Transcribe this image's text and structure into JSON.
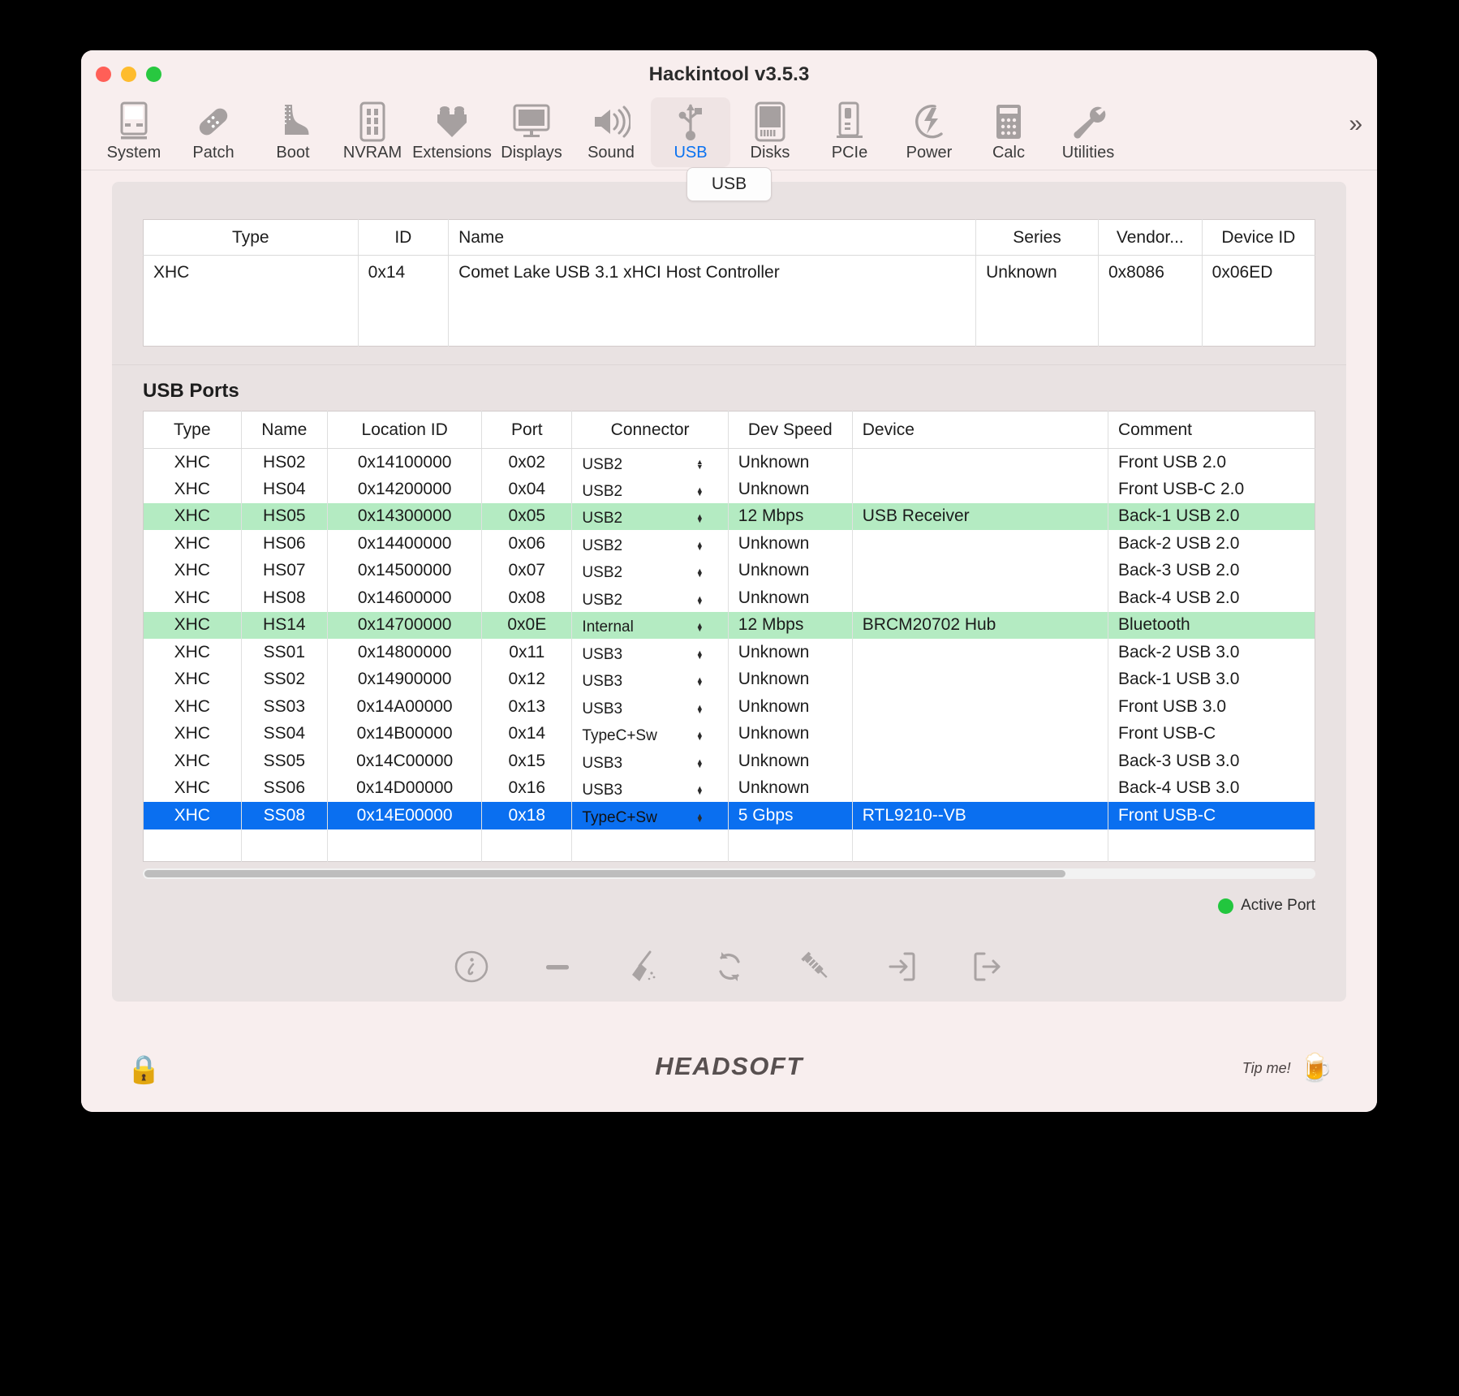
{
  "window": {
    "title": "Hackintool v3.5.3"
  },
  "toolbar": {
    "items": [
      {
        "label": "System",
        "icon": "computer-icon"
      },
      {
        "label": "Patch",
        "icon": "bandage-icon"
      },
      {
        "label": "Boot",
        "icon": "boot-icon"
      },
      {
        "label": "NVRAM",
        "icon": "memory-icon"
      },
      {
        "label": "Extensions",
        "icon": "lego-brick-icon"
      },
      {
        "label": "Displays",
        "icon": "monitor-icon"
      },
      {
        "label": "Sound",
        "icon": "speaker-icon"
      },
      {
        "label": "USB",
        "icon": "usb-icon",
        "active": true
      },
      {
        "label": "Disks",
        "icon": "disk-icon"
      },
      {
        "label": "PCIe",
        "icon": "pcie-card-icon"
      },
      {
        "label": "Power",
        "icon": "bolt-icon"
      },
      {
        "label": "Calc",
        "icon": "calculator-icon"
      },
      {
        "label": "Utilities",
        "icon": "wrench-icon"
      }
    ],
    "overflow": "»"
  },
  "tab": {
    "label": "USB"
  },
  "controller_table": {
    "columns": [
      "Type",
      "ID",
      "Name",
      "Series",
      "Vendor...",
      "Device ID"
    ],
    "rows": [
      {
        "type": "XHC",
        "id": "0x14",
        "name": "Comet Lake USB 3.1 xHCI Host Controller",
        "series": "Unknown",
        "vendor": "0x8086",
        "device_id": "0x06ED"
      }
    ]
  },
  "ports_section": {
    "title": "USB Ports",
    "columns": [
      "Type",
      "Name",
      "Location ID",
      "Port",
      "Connector",
      "Dev Speed",
      "Device",
      "Comment"
    ],
    "rows": [
      {
        "type": "XHC",
        "name": "HS02",
        "location_id": "0x14100000",
        "port": "0x02",
        "connector": "USB2",
        "dev_speed": "Unknown",
        "device": "",
        "comment": "Front USB 2.0",
        "state": "normal"
      },
      {
        "type": "XHC",
        "name": "HS04",
        "location_id": "0x14200000",
        "port": "0x04",
        "connector": "USB2",
        "dev_speed": "Unknown",
        "device": "",
        "comment": "Front USB-C 2.0",
        "state": "normal"
      },
      {
        "type": "XHC",
        "name": "HS05",
        "location_id": "0x14300000",
        "port": "0x05",
        "connector": "USB2",
        "dev_speed": "12 Mbps",
        "device": "USB Receiver",
        "comment": "Back-1 USB 2.0",
        "state": "active"
      },
      {
        "type": "XHC",
        "name": "HS06",
        "location_id": "0x14400000",
        "port": "0x06",
        "connector": "USB2",
        "dev_speed": "Unknown",
        "device": "",
        "comment": "Back-2 USB 2.0",
        "state": "normal"
      },
      {
        "type": "XHC",
        "name": "HS07",
        "location_id": "0x14500000",
        "port": "0x07",
        "connector": "USB2",
        "dev_speed": "Unknown",
        "device": "",
        "comment": "Back-3 USB 2.0",
        "state": "normal"
      },
      {
        "type": "XHC",
        "name": "HS08",
        "location_id": "0x14600000",
        "port": "0x08",
        "connector": "USB2",
        "dev_speed": "Unknown",
        "device": "",
        "comment": "Back-4 USB 2.0",
        "state": "normal"
      },
      {
        "type": "XHC",
        "name": "HS14",
        "location_id": "0x14700000",
        "port": "0x0E",
        "connector": "Internal",
        "dev_speed": "12 Mbps",
        "device": "BRCM20702 Hub",
        "comment": "Bluetooth",
        "state": "active"
      },
      {
        "type": "XHC",
        "name": "SS01",
        "location_id": "0x14800000",
        "port": "0x11",
        "connector": "USB3",
        "dev_speed": "Unknown",
        "device": "",
        "comment": "Back-2 USB 3.0",
        "state": "normal"
      },
      {
        "type": "XHC",
        "name": "SS02",
        "location_id": "0x14900000",
        "port": "0x12",
        "connector": "USB3",
        "dev_speed": "Unknown",
        "device": "",
        "comment": "Back-1 USB 3.0",
        "state": "normal"
      },
      {
        "type": "XHC",
        "name": "SS03",
        "location_id": "0x14A00000",
        "port": "0x13",
        "connector": "USB3",
        "dev_speed": "Unknown",
        "device": "",
        "comment": "Front USB 3.0",
        "state": "normal"
      },
      {
        "type": "XHC",
        "name": "SS04",
        "location_id": "0x14B00000",
        "port": "0x14",
        "connector": "TypeC+Sw",
        "dev_speed": "Unknown",
        "device": "",
        "comment": "Front USB-C",
        "state": "normal"
      },
      {
        "type": "XHC",
        "name": "SS05",
        "location_id": "0x14C00000",
        "port": "0x15",
        "connector": "USB3",
        "dev_speed": "Unknown",
        "device": "",
        "comment": "Back-3 USB 3.0",
        "state": "normal"
      },
      {
        "type": "XHC",
        "name": "SS06",
        "location_id": "0x14D00000",
        "port": "0x16",
        "connector": "USB3",
        "dev_speed": "Unknown",
        "device": "",
        "comment": "Back-4 USB 3.0",
        "state": "normal"
      },
      {
        "type": "XHC",
        "name": "SS08",
        "location_id": "0x14E00000",
        "port": "0x18",
        "connector": "TypeC+Sw",
        "dev_speed": "5 Gbps",
        "device": "RTL9210--VB",
        "comment": "Front USB-C",
        "state": "selected"
      }
    ]
  },
  "legend": {
    "active_port_label": "Active Port",
    "active_port_color": "#22c63e"
  },
  "actions": [
    {
      "name": "info-icon",
      "tooltip": "Info"
    },
    {
      "name": "minus-icon",
      "tooltip": "Remove"
    },
    {
      "name": "broom-icon",
      "tooltip": "Clean"
    },
    {
      "name": "refresh-icon",
      "tooltip": "Refresh"
    },
    {
      "name": "syringe-icon",
      "tooltip": "Inject"
    },
    {
      "name": "import-icon",
      "tooltip": "Import"
    },
    {
      "name": "export-icon",
      "tooltip": "Export"
    }
  ],
  "footer": {
    "lock_icon": "padlock-icon",
    "brand": "HEADSOFT",
    "tip_label": "Tip me!",
    "tip_icon": "beer-mug-icon"
  },
  "colors": {
    "accent_blue": "#0a72f0",
    "selection_blue": "#0a6ff0",
    "active_row_green": "#b4ebc2",
    "window_bg": "#f8eeee",
    "panel_bg": "#e9e2e2"
  }
}
